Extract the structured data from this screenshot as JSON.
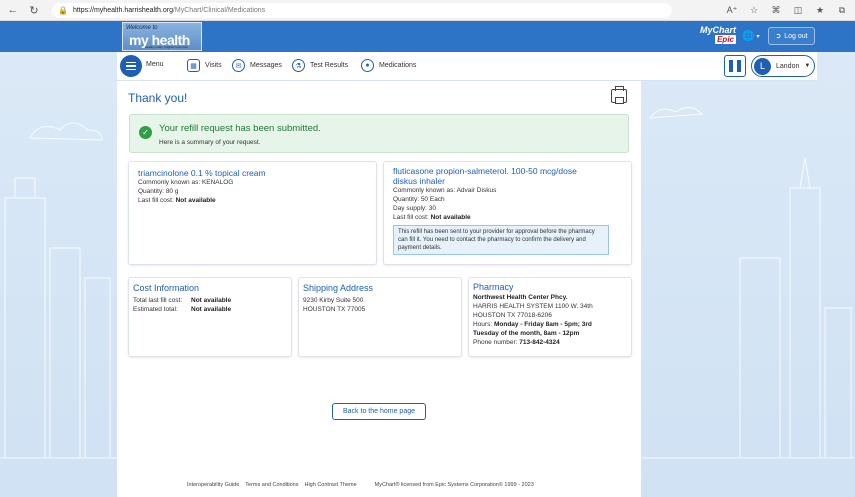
{
  "browser": {
    "url_host": "https://myhealth.harrishealth.org",
    "url_path": "/MyChart/Clinical/Medications"
  },
  "header": {
    "logo_welcome": "Welcome to",
    "logo_name": "my health",
    "logo_tagline": "healthy today, brighter tomorrow",
    "brand_mychart": "MyChart",
    "brand_epic": "Epic",
    "logout_label": "Log out"
  },
  "nav": {
    "menu_label": "Menu",
    "items": [
      {
        "label": "Visits",
        "icon": "calendar-icon"
      },
      {
        "label": "Messages",
        "icon": "envelope-icon"
      },
      {
        "label": "Test Results",
        "icon": "flask-icon"
      },
      {
        "label": "Medications",
        "icon": "pill-icon"
      }
    ],
    "user_initial": "L",
    "user_name": "Landon"
  },
  "page": {
    "title": "Thank you!",
    "success_heading": "Your refill request has been submitted.",
    "success_sub": "Here is a summary of your request."
  },
  "medications": [
    {
      "name": "triamcinolone 0.1 % topical cream",
      "known_as": "Commonly known as: KENALOG",
      "quantity": "Quantity: 80 g",
      "last_cost_label": "Last fill cost:",
      "last_cost_value": "Not available"
    },
    {
      "name_line1": "fluticasone propion-salmeterol. 100-50 mcg/dose",
      "name_line2": "diskus inhaler",
      "known_as": "Commonly known as: Advair Diskus",
      "quantity": "Quantity: 50 Each",
      "day_supply": "Day supply: 30",
      "last_cost_label": "Last fill cost:",
      "last_cost_value": "Not available",
      "note": "This refill has been sent to your provider for approval before the pharmacy can fill it. You need to contact the pharmacy to confirm the delivery and payment details."
    }
  ],
  "cost": {
    "title": "Cost Information",
    "total_label": "Total last fill cost:",
    "total_value": "Not available",
    "est_label": "Estimated total:",
    "est_value": "Not available"
  },
  "shipping": {
    "title": "Shipping Address",
    "line1": "9230 Kirby Suite 500",
    "line2": "HOUSTON TX 77005"
  },
  "pharmacy": {
    "title": "Pharmacy",
    "name": "Northwest Health Center Phcy.",
    "line1": "HARRIS HEALTH SYSTEM 1100 W. 34th",
    "line2": "HOUSTON TX 77018-6206",
    "hours_label": "Hours:",
    "hours_value1": "Monday - Friday 8am - 5pm; 3rd",
    "hours_value2": "Tuesday of the month, 8am - 12pm",
    "phone_label": "Phone number:",
    "phone_value": "713-842-4324"
  },
  "actions": {
    "home_label": "Back to the home page"
  },
  "footer": {
    "links": [
      "Interoperability Guide",
      "Terms and Conditions",
      "High Contrast Theme"
    ],
    "license": "MyChart® licensed from Epic Systems Corporation© 1999 - 2023"
  },
  "colors": {
    "primary": "#1e5fb4",
    "header_bg": "#2e74c6",
    "success_green": "#2e9e47",
    "success_bg": "#e7f4e9"
  }
}
